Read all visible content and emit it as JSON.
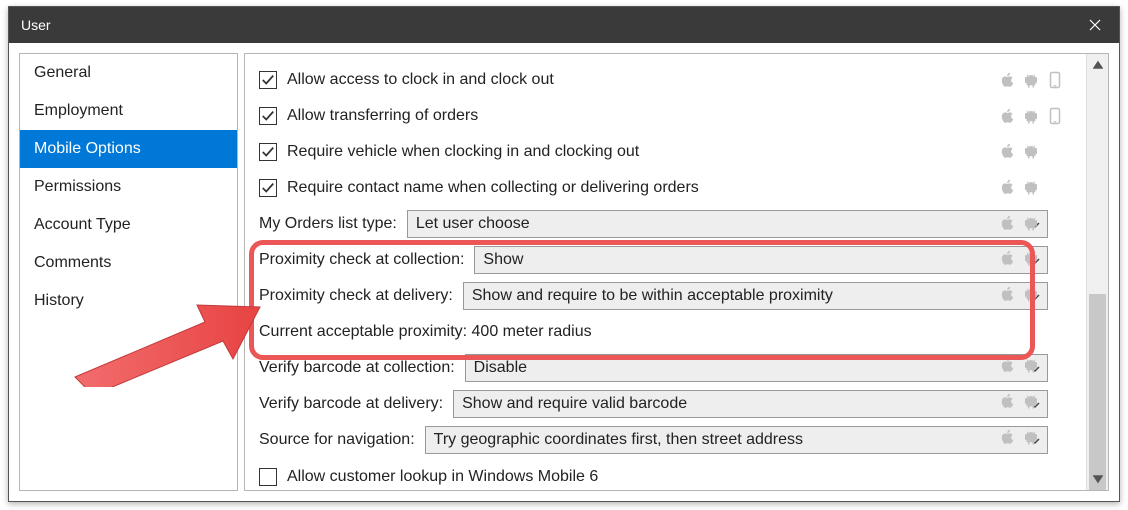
{
  "window": {
    "title": "User"
  },
  "sidebar": {
    "items": [
      {
        "label": "General"
      },
      {
        "label": "Employment"
      },
      {
        "label": "Mobile Options"
      },
      {
        "label": "Permissions"
      },
      {
        "label": "Account Type"
      },
      {
        "label": "Comments"
      },
      {
        "label": "History"
      }
    ],
    "activeIndex": 2
  },
  "settings": {
    "rows": [
      {
        "type": "check",
        "checked": true,
        "label": "Allow access to clock in and clock out"
      },
      {
        "type": "check",
        "checked": true,
        "label": "Allow transferring of orders"
      },
      {
        "type": "check",
        "checked": true,
        "label": "Require vehicle when clocking in and clocking out"
      },
      {
        "type": "check",
        "checked": true,
        "label": "Require contact name when collecting or delivering orders"
      },
      {
        "type": "select",
        "label": "My Orders list type:",
        "value": "Let user choose"
      },
      {
        "type": "select",
        "label": "Proximity check at collection:",
        "value": "Show"
      },
      {
        "type": "select",
        "label": "Proximity check at delivery:",
        "value": "Show and require to be within acceptable proximity"
      },
      {
        "type": "text",
        "label": "Current acceptable proximity: 400 meter radius"
      },
      {
        "type": "select",
        "label": "Verify barcode at collection:",
        "value": "Disable"
      },
      {
        "type": "select",
        "label": "Verify barcode at delivery:",
        "value": "Show and require valid barcode"
      },
      {
        "type": "select",
        "label": "Source for navigation:",
        "value": "Try geographic coordinates first, then street address"
      },
      {
        "type": "check",
        "checked": false,
        "label": "Allow customer lookup in Windows Mobile 6"
      }
    ]
  },
  "platforms": {
    "rows": [
      [
        "apple",
        "android",
        "mobile"
      ],
      [
        "apple",
        "android",
        "mobile"
      ],
      [
        "apple",
        "android"
      ],
      [
        "apple",
        "android"
      ],
      [
        "apple",
        "android"
      ],
      [
        "apple",
        "android"
      ],
      [
        "apple",
        "android"
      ],
      [],
      [
        "apple",
        "android"
      ],
      [
        "apple",
        "android"
      ],
      [
        "apple",
        "android"
      ],
      []
    ]
  }
}
